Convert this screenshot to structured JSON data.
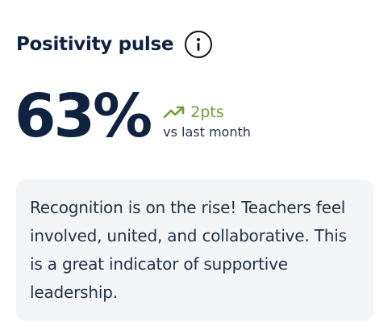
{
  "card": {
    "title": "Positivity pulse",
    "info_icon": "info-circle-icon"
  },
  "metric": {
    "value": "63%",
    "delta_icon": "trending-up-icon",
    "delta_value": "2pts",
    "delta_caption": "vs last month",
    "colors": {
      "value": "#0f2340",
      "delta": "#6aa13a"
    }
  },
  "insight": {
    "text": "Recognition is on the rise! Teachers feel involved, united, and collaborative. This is a great indicator of supportive leadership.",
    "background": "#f3f5f7"
  }
}
